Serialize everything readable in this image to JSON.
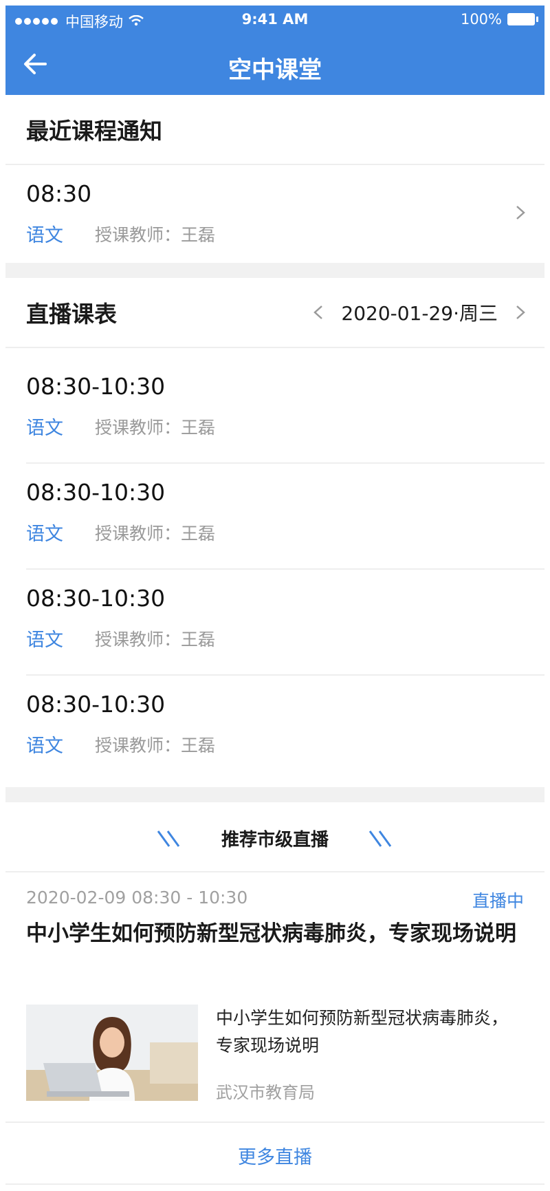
{
  "status": {
    "carrier": "中国移动",
    "time": "9:41 AM",
    "battery": "100%"
  },
  "header": {
    "title": "空中课堂"
  },
  "recent": {
    "title": "最近课程通知",
    "item": {
      "time": "08:30",
      "subject": "语文",
      "teacher": "授课教师：王磊"
    }
  },
  "schedule": {
    "title": "直播课表",
    "date": "2020-01-29·周三",
    "items": [
      {
        "time": "08:30-10:30",
        "subject": "语文",
        "teacher": "授课教师：王磊"
      },
      {
        "time": "08:30-10:30",
        "subject": "语文",
        "teacher": "授课教师：王磊"
      },
      {
        "time": "08:30-10:30",
        "subject": "语文",
        "teacher": "授课教师：王磊"
      },
      {
        "time": "08:30-10:30",
        "subject": "语文",
        "teacher": "授课教师：王磊"
      }
    ]
  },
  "recommend": {
    "title": "推荐市级直播",
    "live": {
      "datetime": "2020-02-09 08:30 - 10:30",
      "status": "直播中",
      "title": "中小学生如何预防新型冠状病毒肺炎，专家现场说明",
      "card_title": "中小学生如何预防新型冠状病毒肺炎，专家现场说明",
      "source": "武汉市教育局"
    },
    "more": "更多直播"
  },
  "colors": {
    "accent": "#3f86e0",
    "header_bg": "#3f86e0",
    "muted": "#9a9a9a"
  }
}
